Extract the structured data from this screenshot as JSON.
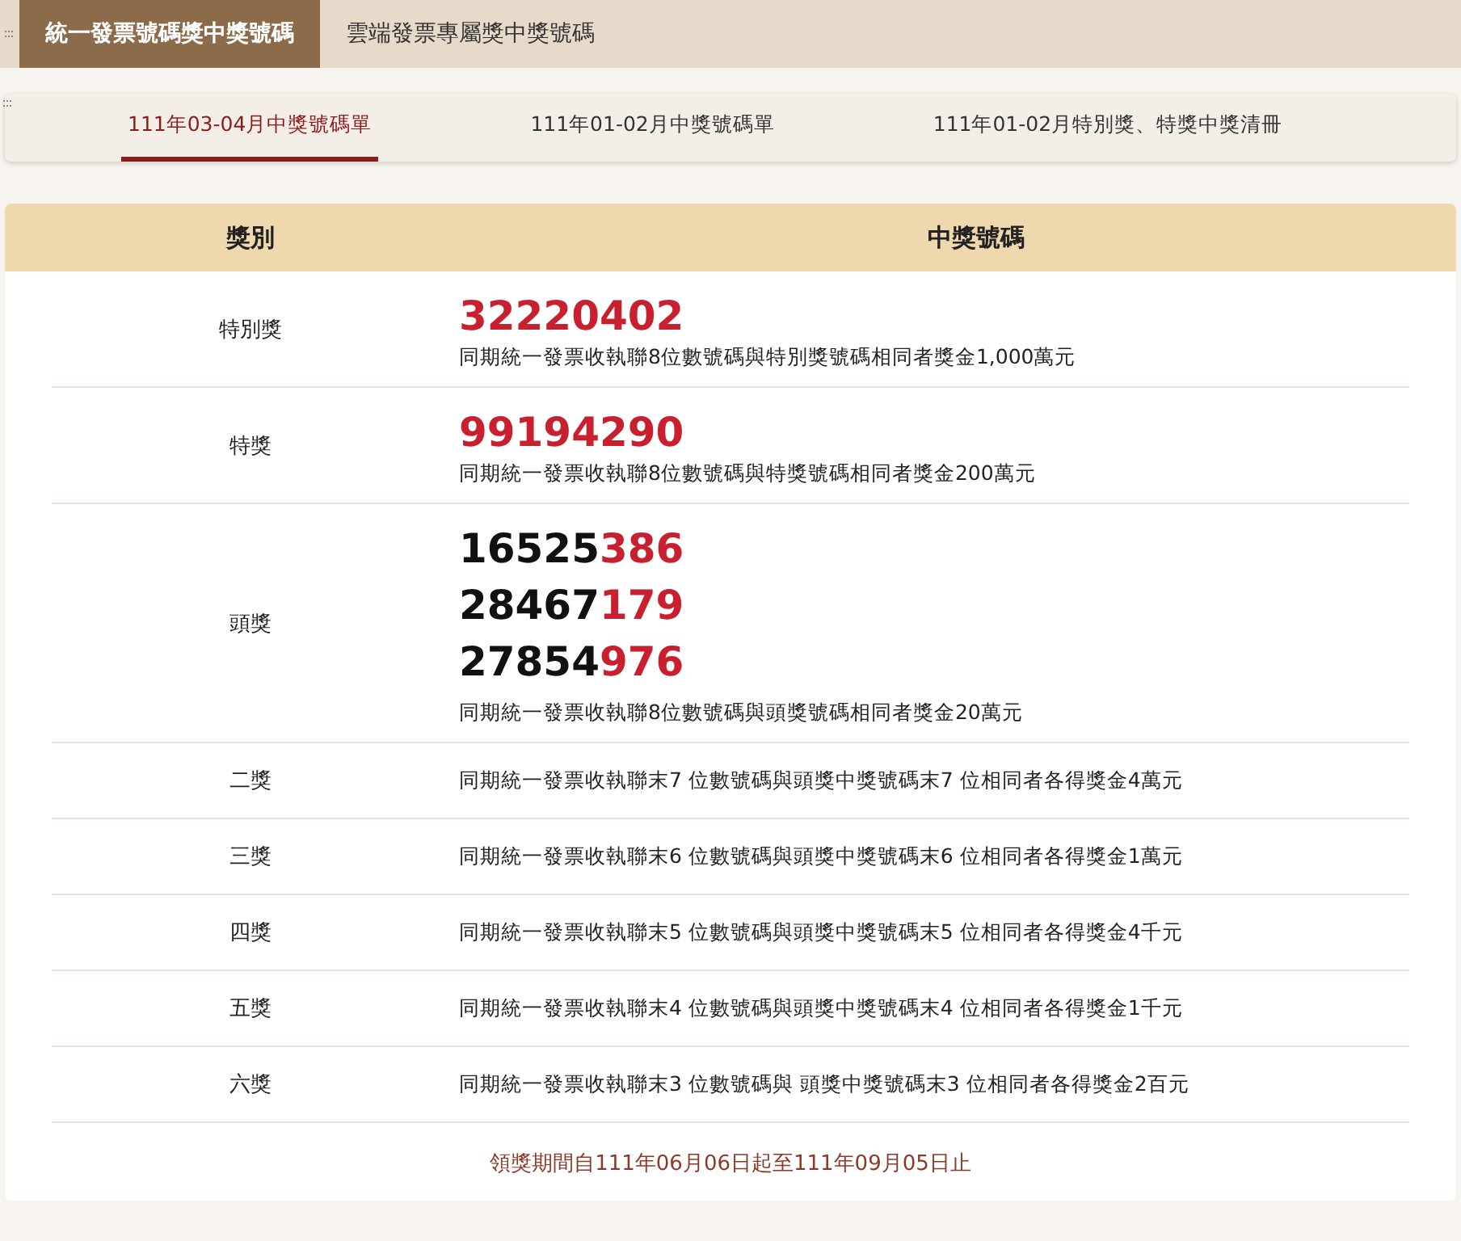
{
  "main_tabs": [
    {
      "label": "統一發票號碼獎中獎號碼",
      "selected": true
    },
    {
      "label": "雲端發票專屬獎中獎號碼",
      "selected": false
    }
  ],
  "period_tabs": [
    {
      "label": "111年03-04月中獎號碼單",
      "selected": true
    },
    {
      "label": "111年01-02月中獎號碼單",
      "selected": false
    },
    {
      "label": "111年01-02月特別獎、特獎中獎清冊",
      "selected": false
    }
  ],
  "table": {
    "columns": [
      "獎別",
      "中獎號碼"
    ],
    "rows": [
      {
        "prize": "特別獎",
        "numbers": [
          {
            "parts": [
              {
                "text": "32220402",
                "red": true
              }
            ]
          }
        ],
        "description": "同期統一發票收執聯8位數號碼與特別獎號碼相同者獎金1,000萬元"
      },
      {
        "prize": "特獎",
        "numbers": [
          {
            "parts": [
              {
                "text": "99194290",
                "red": true
              }
            ]
          }
        ],
        "description": "同期統一發票收執聯8位數號碼與特獎號碼相同者獎金200萬元"
      },
      {
        "prize": "頭獎",
        "numbers": [
          {
            "parts": [
              {
                "text": "16525",
                "red": false
              },
              {
                "text": "386",
                "red": true
              }
            ]
          },
          {
            "parts": [
              {
                "text": "28467",
                "red": false
              },
              {
                "text": "179",
                "red": true
              }
            ]
          },
          {
            "parts": [
              {
                "text": "27854",
                "red": false
              },
              {
                "text": "976",
                "red": true
              }
            ]
          }
        ],
        "description": "同期統一發票收執聯8位數號碼與頭獎號碼相同者獎金20萬元"
      },
      {
        "prize": "二獎",
        "description": "同期統一發票收執聯末7 位數號碼與頭獎中獎號碼末7 位相同者各得獎金4萬元"
      },
      {
        "prize": "三獎",
        "description": "同期統一發票收執聯末6 位數號碼與頭獎中獎號碼末6 位相同者各得獎金1萬元"
      },
      {
        "prize": "四獎",
        "description": "同期統一發票收執聯末5 位數號碼與頭獎中獎號碼末5 位相同者各得獎金4千元"
      },
      {
        "prize": "五獎",
        "description": "同期統一發票收執聯末4 位數號碼與頭獎中獎號碼末4 位相同者各得獎金1千元"
      },
      {
        "prize": "六獎",
        "description": "同期統一發票收執聯末3 位數號碼與 頭獎中獎號碼末3 位相同者各得獎金2百元"
      }
    ]
  },
  "claim_period": "領獎期間自111年06月06日起至111年09月05日止"
}
